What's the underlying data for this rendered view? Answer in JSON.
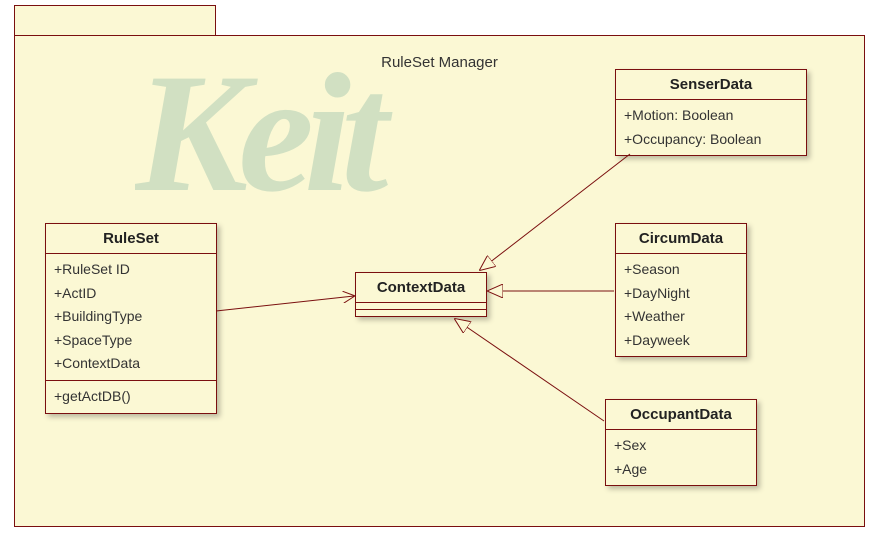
{
  "package": {
    "title": "RuleSet Manager"
  },
  "watermark": {
    "text": "Keit"
  },
  "classes": {
    "ruleset": {
      "name": "RuleSet",
      "attrs": [
        "+RuleSet ID",
        "+ActID",
        "+BuildingType",
        "+SpaceType",
        "+ContextData"
      ],
      "ops": [
        "+getActDB()"
      ]
    },
    "contextdata": {
      "name": "ContextData",
      "attrs": [],
      "ops": []
    },
    "senserdata": {
      "name": "SenserData",
      "attrs": [
        "+Motion: Boolean",
        "+Occupancy: Boolean"
      ],
      "ops": []
    },
    "circumdata": {
      "name": "CircumData",
      "attrs": [
        "+Season",
        "+DayNight",
        "+Weather",
        "+Dayweek"
      ],
      "ops": []
    },
    "occupantdata": {
      "name": "OccupantData",
      "attrs": [
        "+Sex",
        "+Age"
      ],
      "ops": []
    }
  },
  "chart_data": {
    "type": "uml-class-diagram",
    "package": "RuleSet Manager",
    "classes": [
      {
        "name": "RuleSet",
        "attributes": [
          "RuleSet ID",
          "ActID",
          "BuildingType",
          "SpaceType",
          "ContextData"
        ],
        "operations": [
          "getActDB()"
        ]
      },
      {
        "name": "ContextData",
        "attributes": [],
        "operations": []
      },
      {
        "name": "SenserData",
        "attributes": [
          "Motion: Boolean",
          "Occupancy: Boolean"
        ],
        "operations": []
      },
      {
        "name": "CircumData",
        "attributes": [
          "Season",
          "DayNight",
          "Weather",
          "Dayweek"
        ],
        "operations": []
      },
      {
        "name": "OccupantData",
        "attributes": [
          "Sex",
          "Age"
        ],
        "operations": []
      }
    ],
    "relations": [
      {
        "from": "RuleSet",
        "to": "ContextData",
        "type": "association"
      },
      {
        "from": "SenserData",
        "to": "ContextData",
        "type": "generalization"
      },
      {
        "from": "CircumData",
        "to": "ContextData",
        "type": "generalization"
      },
      {
        "from": "OccupantData",
        "to": "ContextData",
        "type": "generalization"
      }
    ]
  }
}
